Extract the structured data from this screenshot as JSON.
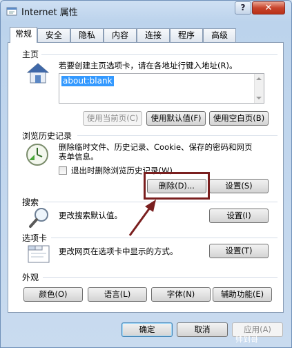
{
  "window": {
    "title": "Internet 属性",
    "help_label": "?",
    "close_label": "✕"
  },
  "tabs": [
    {
      "label": "常规",
      "active": true
    },
    {
      "label": "安全"
    },
    {
      "label": "隐私"
    },
    {
      "label": "内容"
    },
    {
      "label": "连接"
    },
    {
      "label": "程序"
    },
    {
      "label": "高级"
    }
  ],
  "home": {
    "label": "主页",
    "description": "若要创建主页选项卡，请在各地址行键入地址(R)。",
    "address": "about:blank",
    "use_current": "使用当前页(C)",
    "use_default": "使用默认值(F)",
    "use_blank": "使用空白页(B)"
  },
  "history": {
    "label": "浏览历史记录",
    "description_line1": "删除临时文件、历史记录、Cookie、保存的密码和网页",
    "description_line2": "表单信息。",
    "checkbox_label": "退出时删除浏览历史记录(W)",
    "delete": "删除(D)...",
    "settings": "设置(S)"
  },
  "search": {
    "label": "搜索",
    "description": "更改搜索默认值。",
    "settings": "设置(I)"
  },
  "tabs_section": {
    "label": "选项卡",
    "description": "更改网页在选项卡中显示的方式。",
    "settings": "设置(T)"
  },
  "appearance": {
    "label": "外观",
    "colors": "颜色(O)",
    "languages": "语言(L)",
    "fonts": "字体(N)",
    "accessibility": "辅助功能(E)"
  },
  "footer": {
    "ok": "确定",
    "cancel": "取消",
    "apply": "应用(A)"
  },
  "watermark": "帅到哥",
  "colors": {
    "highlight": "#7a1f1f",
    "selection": "#3399ff",
    "close_red": "#c8442c"
  }
}
